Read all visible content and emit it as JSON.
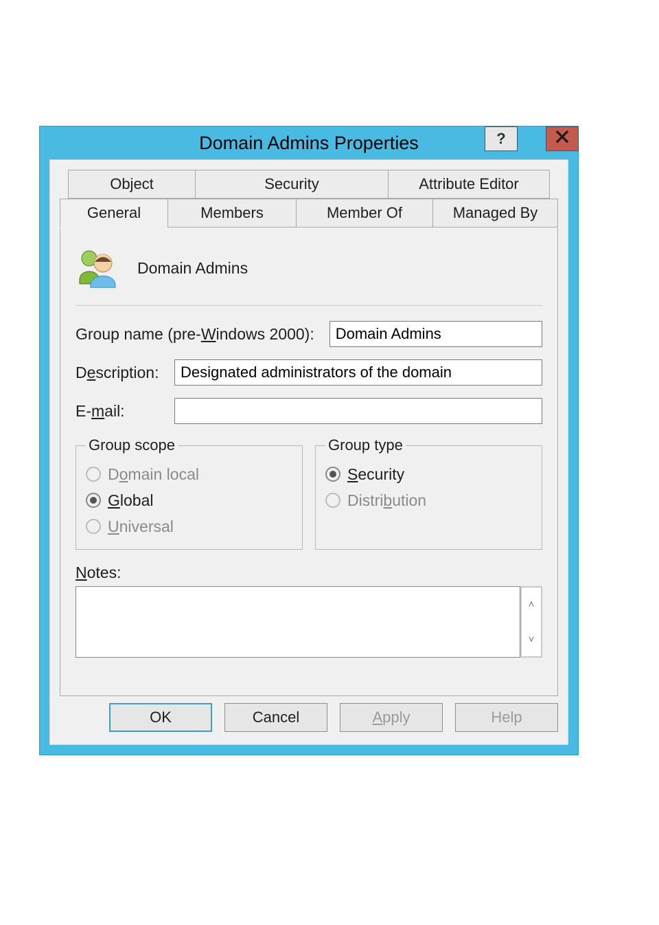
{
  "window": {
    "title": "Domain Admins Properties",
    "help_label": "?",
    "close_label": "x"
  },
  "tabs_row1": [
    "Object",
    "Security",
    "Attribute Editor"
  ],
  "tabs_row2": [
    "General",
    "Members",
    "Member Of",
    "Managed By"
  ],
  "active_tab": "General",
  "general": {
    "display_name": "Domain Admins",
    "labels": {
      "pre2000": "Group name (pre-Windows 2000):",
      "description": "Description:",
      "email": "E-mail:",
      "group_scope": "Group scope",
      "group_type": "Group type",
      "notes": "Notes:"
    },
    "underline": {
      "pre2000_char": "W",
      "description_char": "e",
      "email_char": "m",
      "notes_char": "N",
      "domain_local_char": "o",
      "global_char": "G",
      "universal_char": "U",
      "security_char": "S",
      "distribution_char": "b",
      "apply_char": "A"
    },
    "values": {
      "pre2000": "Domain Admins",
      "description": "Designated administrators of the domain",
      "email": "",
      "notes": ""
    },
    "scope_options": [
      {
        "label": "Domain local",
        "selected": false,
        "disabled": true
      },
      {
        "label": "Global",
        "selected": true,
        "disabled": false
      },
      {
        "label": "Universal",
        "selected": false,
        "disabled": true
      }
    ],
    "type_options": [
      {
        "label": "Security",
        "selected": true,
        "disabled": false
      },
      {
        "label": "Distribution",
        "selected": false,
        "disabled": true
      }
    ]
  },
  "buttons": {
    "ok": "OK",
    "cancel": "Cancel",
    "apply": "Apply",
    "help": "Help"
  }
}
